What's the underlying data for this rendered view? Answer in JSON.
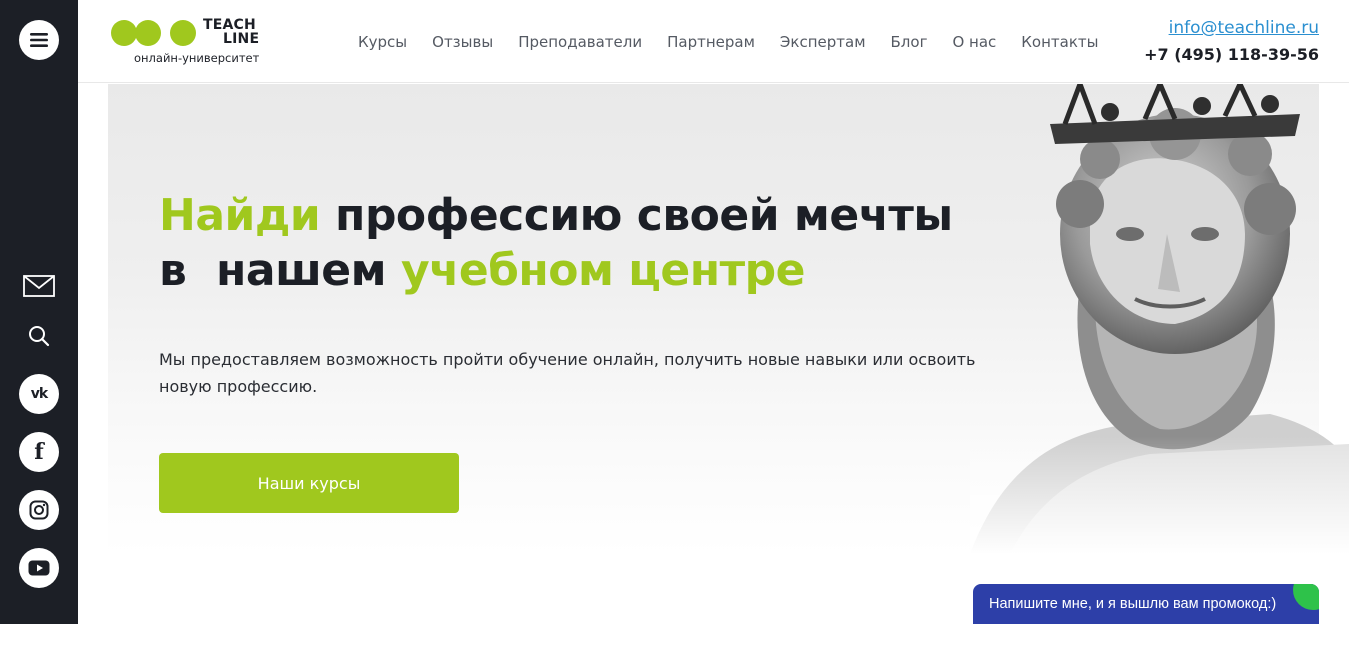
{
  "logo": {
    "word_line1": "TEACH",
    "word_line2": "LINE",
    "subtitle": "онлайн-университет"
  },
  "nav": [
    "Курсы",
    "Отзывы",
    "Преподаватели",
    "Партнерам",
    "Экспертам",
    "Блог",
    "О нас",
    "Контакты"
  ],
  "contacts": {
    "email": "info@teachline.ru",
    "phone": "+7 (495) 118-39-56"
  },
  "sidebar": {
    "icons": [
      "menu-icon",
      "mail-icon",
      "search-icon",
      "vk-icon",
      "facebook-icon",
      "instagram-icon",
      "youtube-icon"
    ],
    "vk_text": "vk",
    "fb_text": "f"
  },
  "hero": {
    "title_part1": "Найди",
    "title_part2": " профессию своей мечты",
    "title_part3": "в  нашем ",
    "title_part4": "учебном центре",
    "description": "Мы предоставляем возможность пройти обучение онлайн, получить новые навыки или освоить новую профессию.",
    "cta_label": "Наши курсы"
  },
  "chat": {
    "label": "Напишите мне, и я вышлю вам промокод:)"
  },
  "colors": {
    "accent": "#a0c81e",
    "dark": "#1c1f26",
    "link": "#2a8fd0",
    "chat": "#2d3fa8",
    "online": "#2ec24a"
  }
}
